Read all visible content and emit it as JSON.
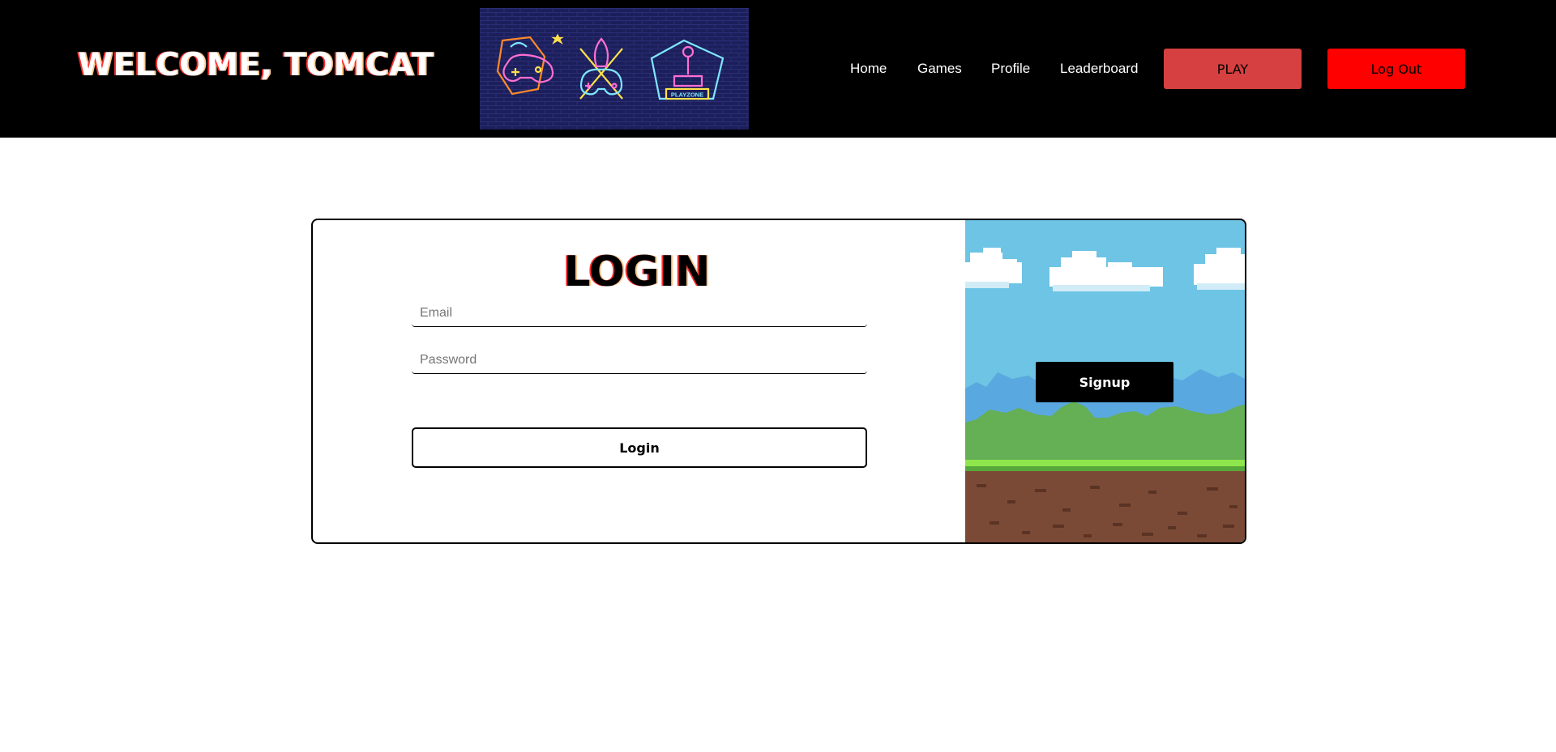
{
  "header": {
    "welcome_text": "WELCOME, TOMCAT",
    "banner_badge_text": "PLAYZONE",
    "nav": [
      {
        "label": "Home"
      },
      {
        "label": "Games"
      },
      {
        "label": "Profile"
      },
      {
        "label": "Leaderboard"
      }
    ],
    "play_label": "PLAY",
    "logout_label": "Log Out"
  },
  "login_form": {
    "title": "LOGIN",
    "email_placeholder": "Email",
    "email_value": "",
    "password_placeholder": "Password",
    "password_value": "",
    "submit_label": "Login"
  },
  "signup_panel": {
    "signup_label": "Signup"
  },
  "colors": {
    "topbar": "#000000",
    "play_button": "#d64040",
    "logout_button": "#ff0000",
    "sky": "#6dc4e4",
    "grass": "#65af55",
    "dirt": "#7b4a36"
  }
}
